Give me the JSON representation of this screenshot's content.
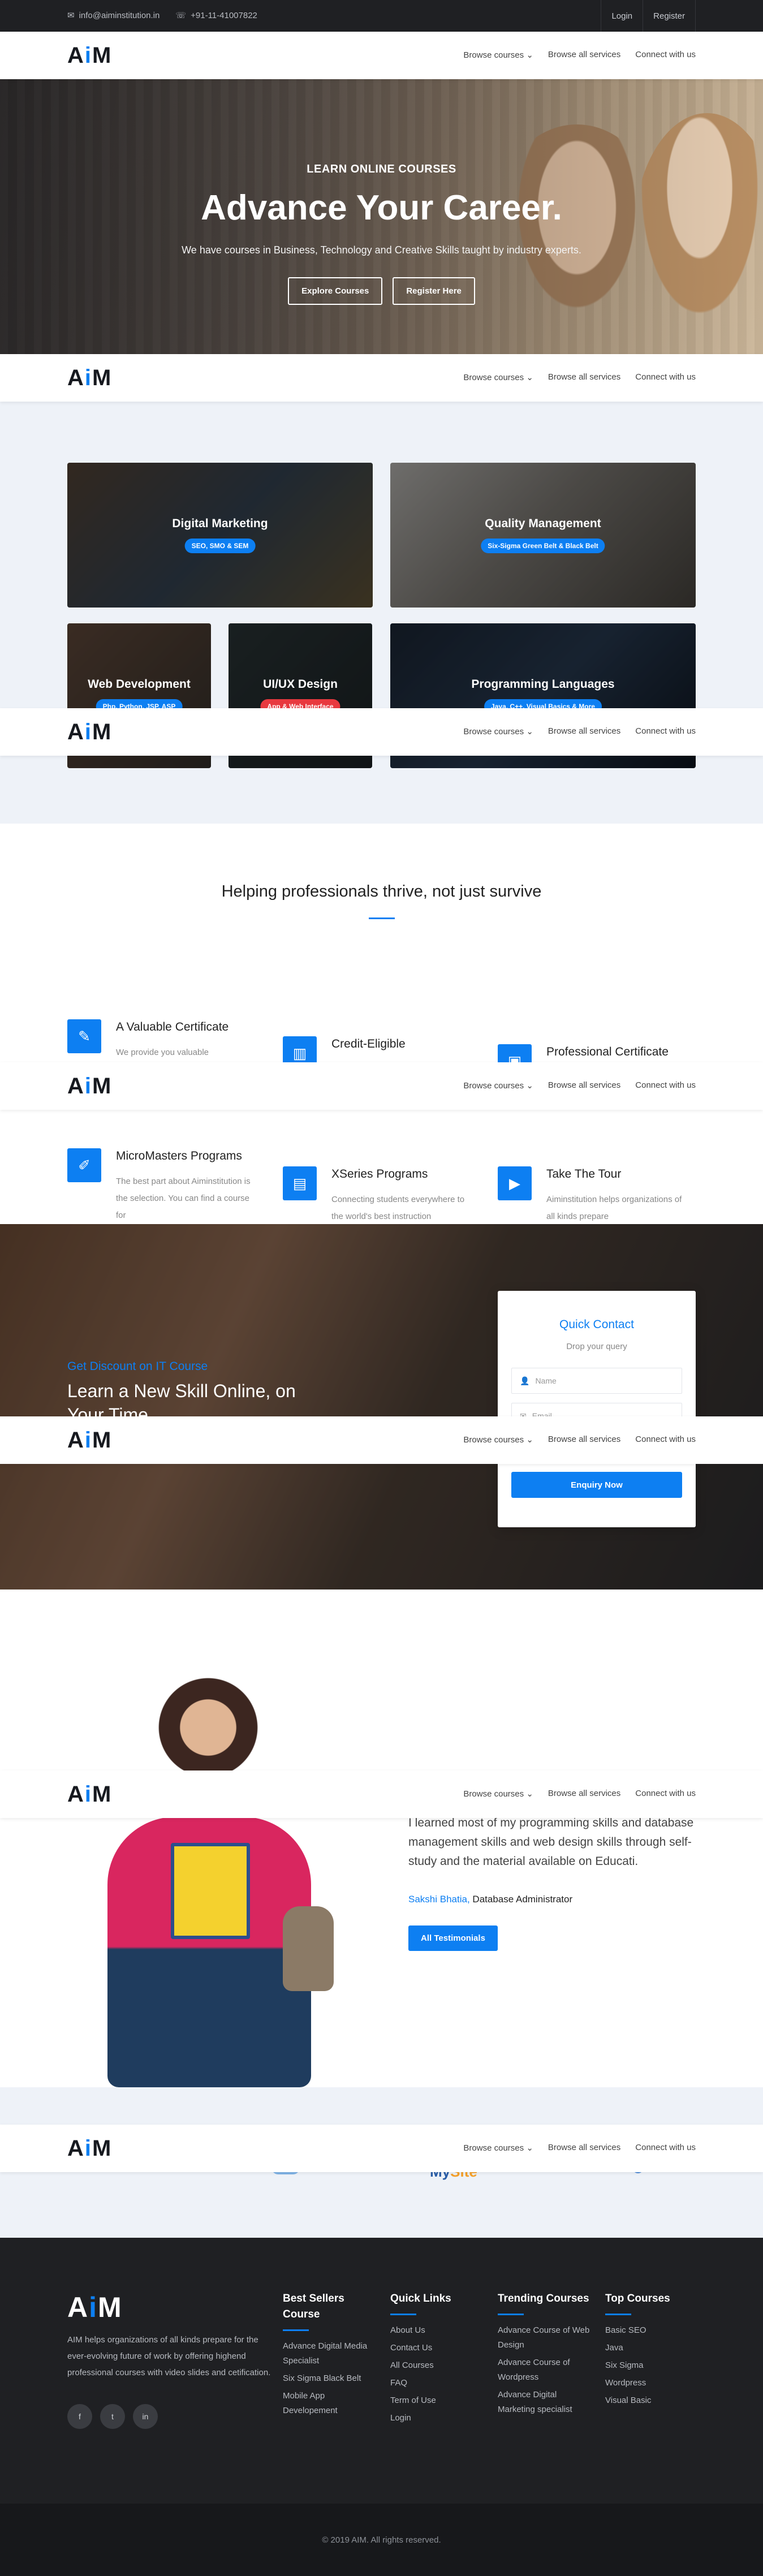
{
  "topbar": {
    "email": "info@aiminstitution.in",
    "phone": "+91-11-41007822",
    "login": "Login",
    "register": "Register"
  },
  "nav": {
    "logo_a": "A",
    "logo_i": "i",
    "logo_m": "M",
    "browse_courses": "Browse courses",
    "browse_services": "Browse all services",
    "connect": "Connect with us"
  },
  "hero": {
    "kicker": "LEARN ONLINE COURSES",
    "title": "Advance Your Career.",
    "subtitle": "We have courses in Business, Technology and Creative Skills taught by industry experts.",
    "explore": "Explore Courses",
    "register": "Register Here"
  },
  "courses": [
    {
      "title": "Digital Marketing",
      "tag": "SEO, SMO & SEM"
    },
    {
      "title": "Quality Management",
      "tag": "Six-Sigma Green Belt & Black Belt"
    },
    {
      "title": "Web Development",
      "tag": "Php, Python, JSP, ASP"
    },
    {
      "title": "UI/UX Design",
      "tag": "App & Web Interface"
    },
    {
      "title": "Programming Languages",
      "tag": "Java, C++, Visual Basics & More"
    }
  ],
  "helping": {
    "title": "Helping professionals thrive, not just survive",
    "features": [
      {
        "title": "A Valuable Certificate",
        "text": "We provide you valuable",
        "icon": "pencil-square-icon"
      },
      {
        "title": "Credit-Eligible",
        "text": "",
        "icon": "building-icon"
      },
      {
        "title": "Professional Certificate",
        "text": "",
        "icon": "certificate-icon"
      },
      {
        "title": "MicroMasters Programs",
        "text": "The best part about Aiminstitution is the selection. You can find a course for",
        "icon": "pencil-icon"
      },
      {
        "title": "XSeries Programs",
        "text": "Connecting students everywhere to the world's best instruction",
        "icon": "book-icon"
      },
      {
        "title": "Take The Tour",
        "text": "Aiminstitution helps organizations of all kinds prepare",
        "icon": "video-icon"
      }
    ]
  },
  "discount": {
    "kicker": "Get Discount on IT Course",
    "title": "Learn a New Skill Online, on Your Time"
  },
  "quick_contact": {
    "title": "Quick Contact",
    "subtitle": "Drop your query",
    "name_placeholder": "Name",
    "email_placeholder": "Email",
    "button": "Enquiry Now"
  },
  "testimonial": {
    "quote": "I learned most of my programming skills and database management skills and web design skills through self-study and the material available on Educati.",
    "name": "Sakshi Bhatia,",
    "role": "Database Administrator",
    "button": "All Testimonials"
  },
  "partners": {
    "logo_b_text_1": "My",
    "logo_b_text_2": "Site"
  },
  "footer": {
    "about": "AIM helps organizations of all kinds prepare for the ever-evolving future of work by offering highend professional courses with video slides and cetification.",
    "social": [
      "f",
      "t",
      "in"
    ],
    "columns": [
      {
        "title": "Best Sellers Course",
        "items": [
          "Advance Digital Media Specialist",
          "Six Sigma Black Belt",
          "Mobile App Developement"
        ]
      },
      {
        "title": "Quick Links",
        "items": [
          "About Us",
          "Contact Us",
          "All Courses",
          "FAQ",
          "Term of Use",
          "Login"
        ]
      },
      {
        "title": "Trending Courses",
        "items": [
          "Advance Course of Web Design",
          "Advance Course of Wordpress",
          "Advance Digital Marketing specialist"
        ]
      },
      {
        "title": "Top Courses",
        "items": [
          "Basic SEO",
          "Java",
          "Six Sigma",
          "Wordpress",
          "Visual Basic"
        ]
      }
    ],
    "copyright": "© 2019 AIM. All rights reserved."
  },
  "colors": {
    "accent": "#0d7ff2",
    "dark": "#1f2023",
    "light_bg": "#eef2f8",
    "tag_red": "#e8393f"
  }
}
